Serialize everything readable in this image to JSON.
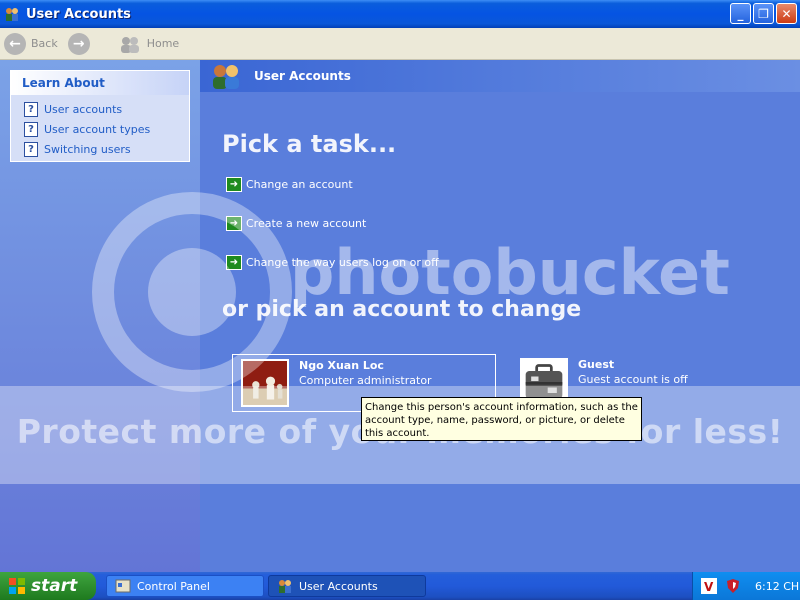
{
  "window": {
    "title": "User Accounts",
    "minimize": "_",
    "maximize": "❐",
    "close": "✕"
  },
  "toolbar": {
    "back_label": "Back",
    "home_label": "Home"
  },
  "learn_about": {
    "header": "Learn About",
    "items": [
      {
        "label": "User accounts"
      },
      {
        "label": "User account types"
      },
      {
        "label": "Switching users"
      }
    ]
  },
  "main": {
    "header_title": "User Accounts",
    "pick_task": "Pick a task...",
    "tasks": [
      {
        "label": "Change an account"
      },
      {
        "label": "Create a new account"
      },
      {
        "label": "Change the way users log on or off"
      }
    ],
    "or_pick": "or pick an account to change",
    "accounts": [
      {
        "name": "Ngo Xuan Loc",
        "desc": "Computer administrator"
      },
      {
        "name": "Guest",
        "desc": "Guest account is off"
      }
    ],
    "tooltip": "Change this person's account information, such as the account type, name, password, or picture, or delete this account."
  },
  "watermark": {
    "logo": "photobucket",
    "text": "Protect more of your memories for less!"
  },
  "taskbar": {
    "start_label": "start",
    "tasks": [
      {
        "label": "Control Panel"
      },
      {
        "label": "User Accounts"
      }
    ],
    "clock": "6:12 CH"
  }
}
